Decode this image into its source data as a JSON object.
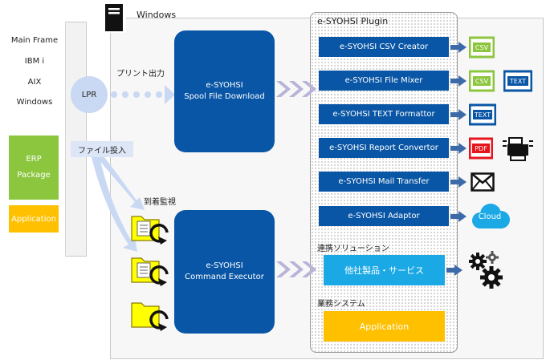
{
  "host": {
    "labels": [
      "Main Frame",
      "IBM i",
      "AIX",
      "Windows"
    ],
    "erp_line1": "ERP",
    "erp_line2": "Package",
    "application": "Application"
  },
  "windows": {
    "label": "Windows"
  },
  "flow": {
    "lpr": "LPR",
    "print_output": "プリント出力",
    "file_input": "ファイル投入",
    "arrival_watch": "到着監視"
  },
  "processes": {
    "spool_line1": "e-SYOHSI",
    "spool_line2": "Spool File Download",
    "exec_line1": "e-SYOHSI",
    "exec_line2": "Command Executor"
  },
  "plugin": {
    "title": "e-SYOHSI Plugin",
    "items": [
      "e-SYOHSI CSV Creator",
      "e-SYOHSI File Mixer",
      "e-SYOHSI TEXT Formattor",
      "e-SYOHSI Report Convertor",
      "e-SYOHSI Mail Transfer",
      "e-SYOHSI Adaptor"
    ]
  },
  "solutions": {
    "label": "連携ソリューション",
    "box": "他社製品・サービス"
  },
  "business": {
    "label": "業務システム",
    "application": "Application"
  },
  "outputs": {
    "csv1": "CSV",
    "csv2": "CSV",
    "text1": "TEXT",
    "text2": "TEXT",
    "pdf": "PDF",
    "cloud": "Cloud"
  },
  "colors": {
    "brand_blue": "#0a56a6",
    "green": "#8cc63f",
    "yellow": "#ffc000",
    "cyan": "#1ba9e6",
    "light_blue": "#c9d8f3",
    "pdf_red": "#e8141c"
  }
}
